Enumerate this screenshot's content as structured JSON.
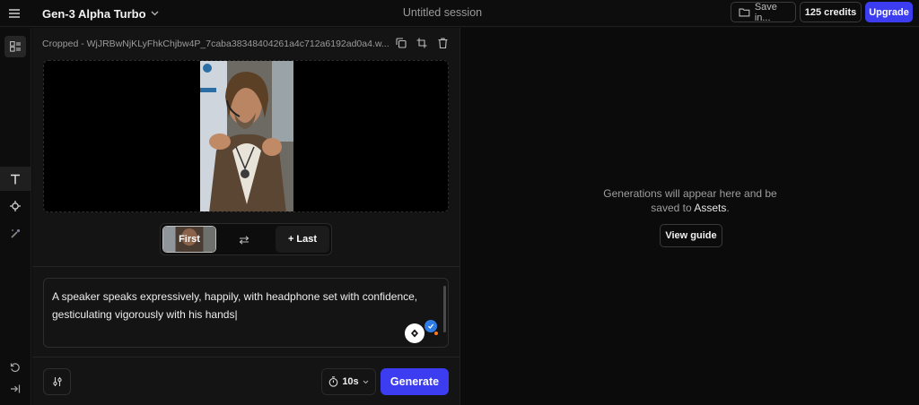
{
  "header": {
    "model_name": "Gen-3 Alpha Turbo",
    "session_title": "Untitled session",
    "save_label": "Save in...",
    "credits_label": "125 credits",
    "upgrade_label": "Upgrade"
  },
  "editor": {
    "file_name": "Cropped - WjJRBwNjKLyFhkChjbw4P_7caba38348404261a4c712a6192ad0a4.w...",
    "frames": {
      "first_label": "First",
      "last_label": "+ Last"
    },
    "prompt_text": "A speaker speaks expressively, happily, with headphone set with confidence, gesticulating vigorously with his hands",
    "duration_label": "10s",
    "generate_label": "Generate"
  },
  "preview": {
    "empty_message_line1": "Generations will appear here and be",
    "empty_message_line2_prefix": "saved to ",
    "assets_link_label": "Assets",
    "empty_message_line2_suffix": ".",
    "view_guide_label": "View guide"
  },
  "colors": {
    "accent": "#3c3cf0",
    "background": "#0d0d0d",
    "panel": "#141414"
  },
  "icons": {
    "menu": "hamburger-icon",
    "model_chevron": "chevron-down-icon",
    "save_folder": "folder-icon",
    "rail_library": "library-icon",
    "rail_text": "text-icon",
    "rail_camera": "camera-motion-icon",
    "rail_brush": "magic-brush-icon",
    "rail_reset": "refresh-icon",
    "rail_collapse": "collapse-panel-icon",
    "copy": "copy-icon",
    "crop": "crop-icon",
    "delete": "trash-icon",
    "swap": "swap-arrows-icon",
    "settings": "settings-sliders-icon",
    "timer": "timer-icon",
    "assist": "prompt-assist-icon"
  }
}
